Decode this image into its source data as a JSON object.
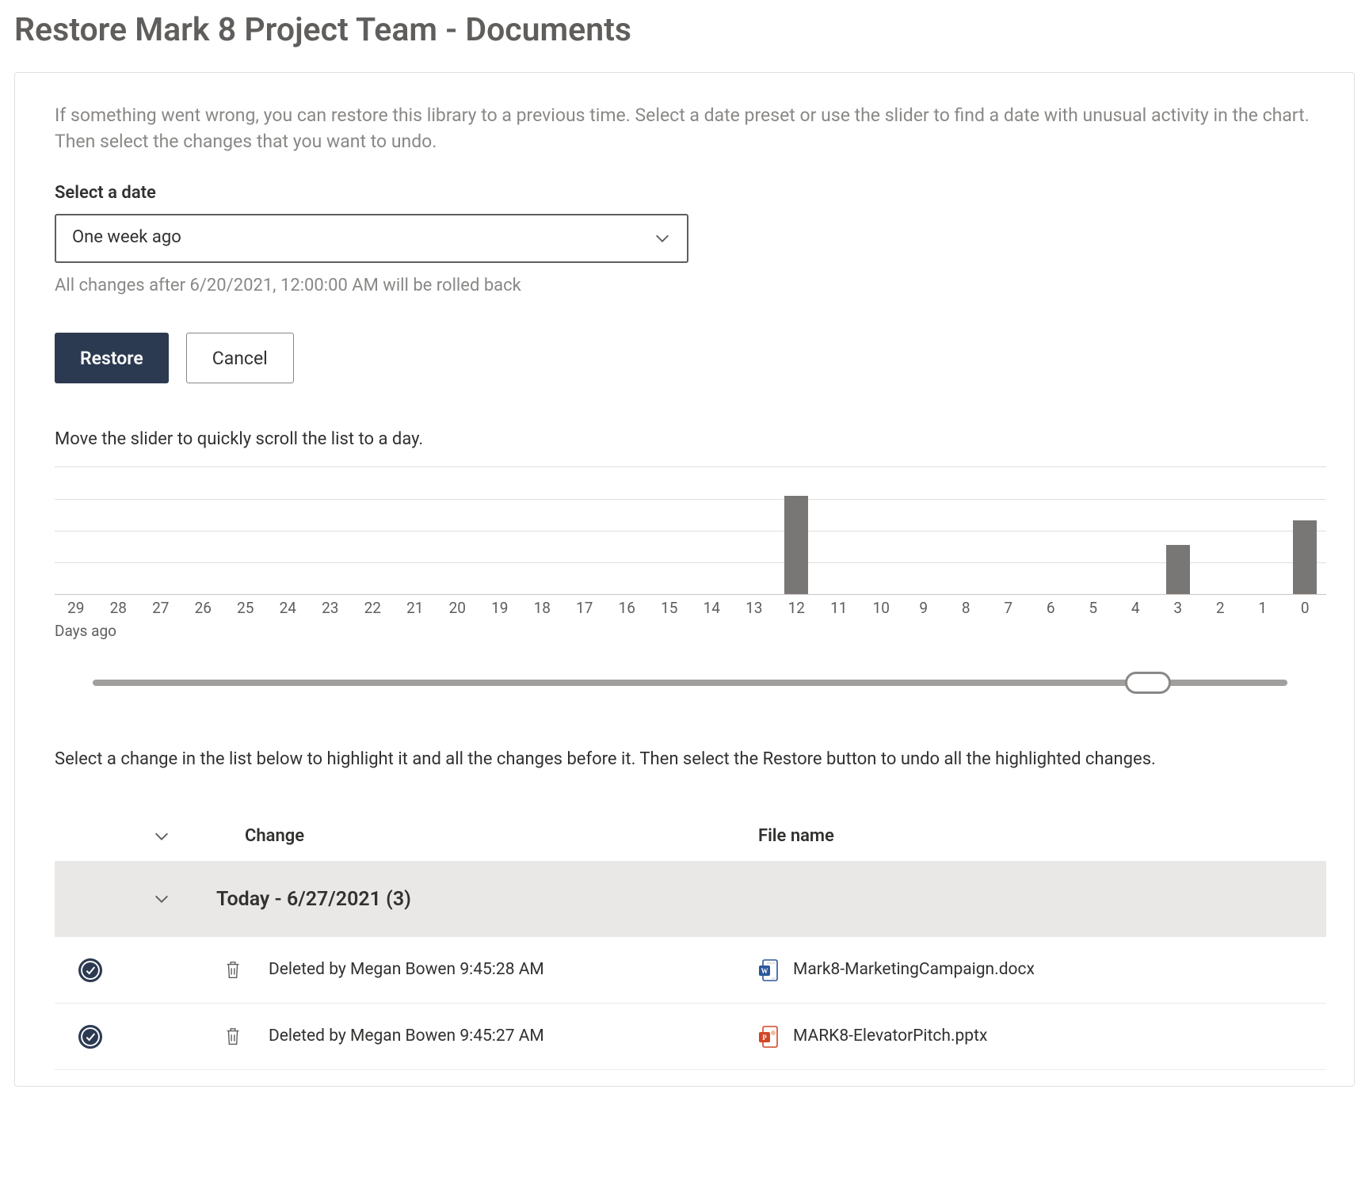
{
  "page_title": "Restore Mark 8 Project Team - Documents",
  "intro": "If something went wrong, you can restore this library to a previous time. Select a date preset or use the slider to find a date with unusual activity in the chart. Then select the changes that you want to undo.",
  "select_date": {
    "label": "Select a date",
    "value": "One week ago",
    "hint": "All changes after 6/20/2021, 12:00:00 AM will be rolled back"
  },
  "buttons": {
    "restore": "Restore",
    "cancel": "Cancel"
  },
  "slider_instruction": "Move the slider to quickly scroll the list to a day.",
  "chart_data": {
    "type": "bar",
    "categories": [
      "29",
      "28",
      "27",
      "26",
      "25",
      "24",
      "23",
      "22",
      "21",
      "20",
      "19",
      "18",
      "17",
      "16",
      "15",
      "14",
      "13",
      "12",
      "11",
      "10",
      "9",
      "8",
      "7",
      "6",
      "5",
      "4",
      "3",
      "2",
      "1",
      "0"
    ],
    "values": [
      0,
      0,
      0,
      0,
      0,
      0,
      0,
      0,
      0,
      0,
      0,
      0,
      0,
      0,
      0,
      0,
      0,
      4,
      0,
      0,
      0,
      0,
      0,
      0,
      0,
      0,
      2,
      0,
      0,
      3
    ],
    "xlabel": "Days ago",
    "ylabel": "",
    "ylim": [
      0,
      5
    ],
    "title": ""
  },
  "slider_position_days_ago": 3,
  "list_instruction": "Select a change in the list below to highlight it and all the changes before it. Then select the Restore button to undo all the highlighted changes.",
  "columns": {
    "change": "Change",
    "filename": "File name"
  },
  "groups": [
    {
      "label": "Today - 6/27/2021 (3)",
      "rows": [
        {
          "selected": true,
          "change": "Deleted by Megan Bowen 9:45:28 AM",
          "file_type": "docx",
          "file_name": "Mark8-MarketingCampaign.docx"
        },
        {
          "selected": true,
          "change": "Deleted by Megan Bowen 9:45:27 AM",
          "file_type": "pptx",
          "file_name": "MARK8-ElevatorPitch.pptx"
        }
      ]
    }
  ]
}
